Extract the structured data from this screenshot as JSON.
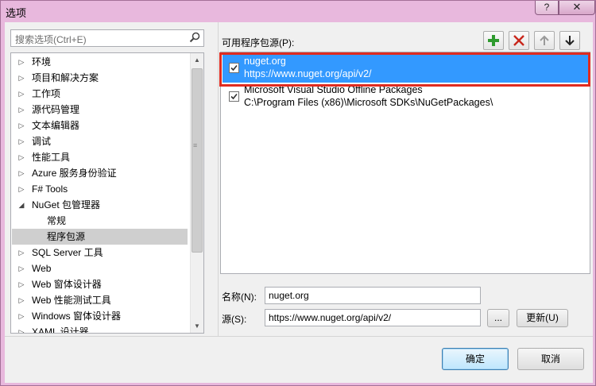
{
  "window": {
    "title": "选项",
    "help_label": "?",
    "close_label": "✕"
  },
  "search": {
    "placeholder": "搜索选项(Ctrl+E)"
  },
  "tree": {
    "items": [
      {
        "label": "环境",
        "expander": "▷"
      },
      {
        "label": "项目和解决方案",
        "expander": "▷"
      },
      {
        "label": "工作项",
        "expander": "▷"
      },
      {
        "label": "源代码管理",
        "expander": "▷"
      },
      {
        "label": "文本编辑器",
        "expander": "▷"
      },
      {
        "label": "调试",
        "expander": "▷"
      },
      {
        "label": "性能工具",
        "expander": "▷"
      },
      {
        "label": "Azure 服务身份验证",
        "expander": "▷"
      },
      {
        "label": "F# Tools",
        "expander": "▷"
      },
      {
        "label": "NuGet 包管理器",
        "expander": "◢"
      },
      {
        "label": "常规",
        "expander": ""
      },
      {
        "label": "程序包源",
        "expander": ""
      },
      {
        "label": "SQL Server 工具",
        "expander": "▷"
      },
      {
        "label": "Web",
        "expander": "▷"
      },
      {
        "label": "Web 窗体设计器",
        "expander": "▷"
      },
      {
        "label": "Web 性能测试工具",
        "expander": "▷"
      },
      {
        "label": "Windows 窗体设计器",
        "expander": "▷"
      },
      {
        "label": "XAML 设计器",
        "expander": "▷"
      }
    ],
    "selected_index": 11
  },
  "sources": {
    "label": "可用程序包源(P):",
    "toolbar": {
      "add_icon": "plus-icon",
      "remove_icon": "x-icon",
      "up_icon": "arrow-up-icon",
      "down_icon": "arrow-down-icon",
      "add_color": "#2e9a2e",
      "remove_color": "#c8261b"
    },
    "items": [
      {
        "name": "nuget.org",
        "url": "https://www.nuget.org/api/v2/",
        "checked": true
      },
      {
        "name": "Microsoft Visual Studio Offline Packages",
        "url": "C:\\Program Files (x86)\\Microsoft SDKs\\NuGetPackages\\",
        "checked": true
      }
    ],
    "selected_index": 0
  },
  "form": {
    "name_label": "名称(N):",
    "name_value": "nuget.org",
    "source_label": "源(S):",
    "source_value": "https://www.nuget.org/api/v2/",
    "browse_label": "...",
    "update_label": "更新(U)"
  },
  "footer": {
    "ok_label": "确定",
    "cancel_label": "取消"
  },
  "colors": {
    "selection": "#3399ff",
    "highlight_box": "#e02b20"
  }
}
